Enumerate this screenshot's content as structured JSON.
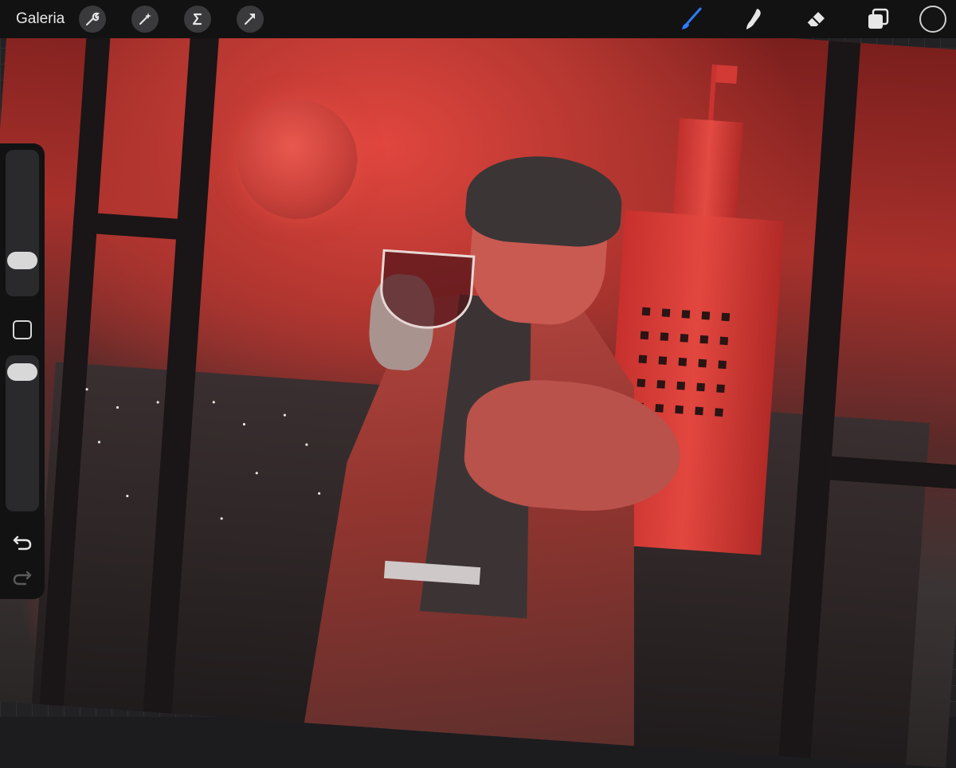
{
  "topbar": {
    "gallery_label": "Galeria",
    "left_tools": [
      {
        "name": "actions-icon"
      },
      {
        "name": "adjustments-icon"
      },
      {
        "name": "selection-icon"
      },
      {
        "name": "transform-icon"
      }
    ],
    "right_tools": [
      {
        "name": "brush-icon",
        "active": true
      },
      {
        "name": "smudge-icon"
      },
      {
        "name": "eraser-icon"
      },
      {
        "name": "layers-icon"
      }
    ],
    "current_color": "#141414",
    "accent": "#2f7df6"
  },
  "sidebar": {
    "items": [
      {
        "name": "brush-size-slider"
      },
      {
        "name": "modifier-button"
      },
      {
        "name": "opacity-slider"
      },
      {
        "name": "undo-icon"
      },
      {
        "name": "redo-icon"
      }
    ]
  },
  "canvas": {
    "subject": "artwork"
  }
}
